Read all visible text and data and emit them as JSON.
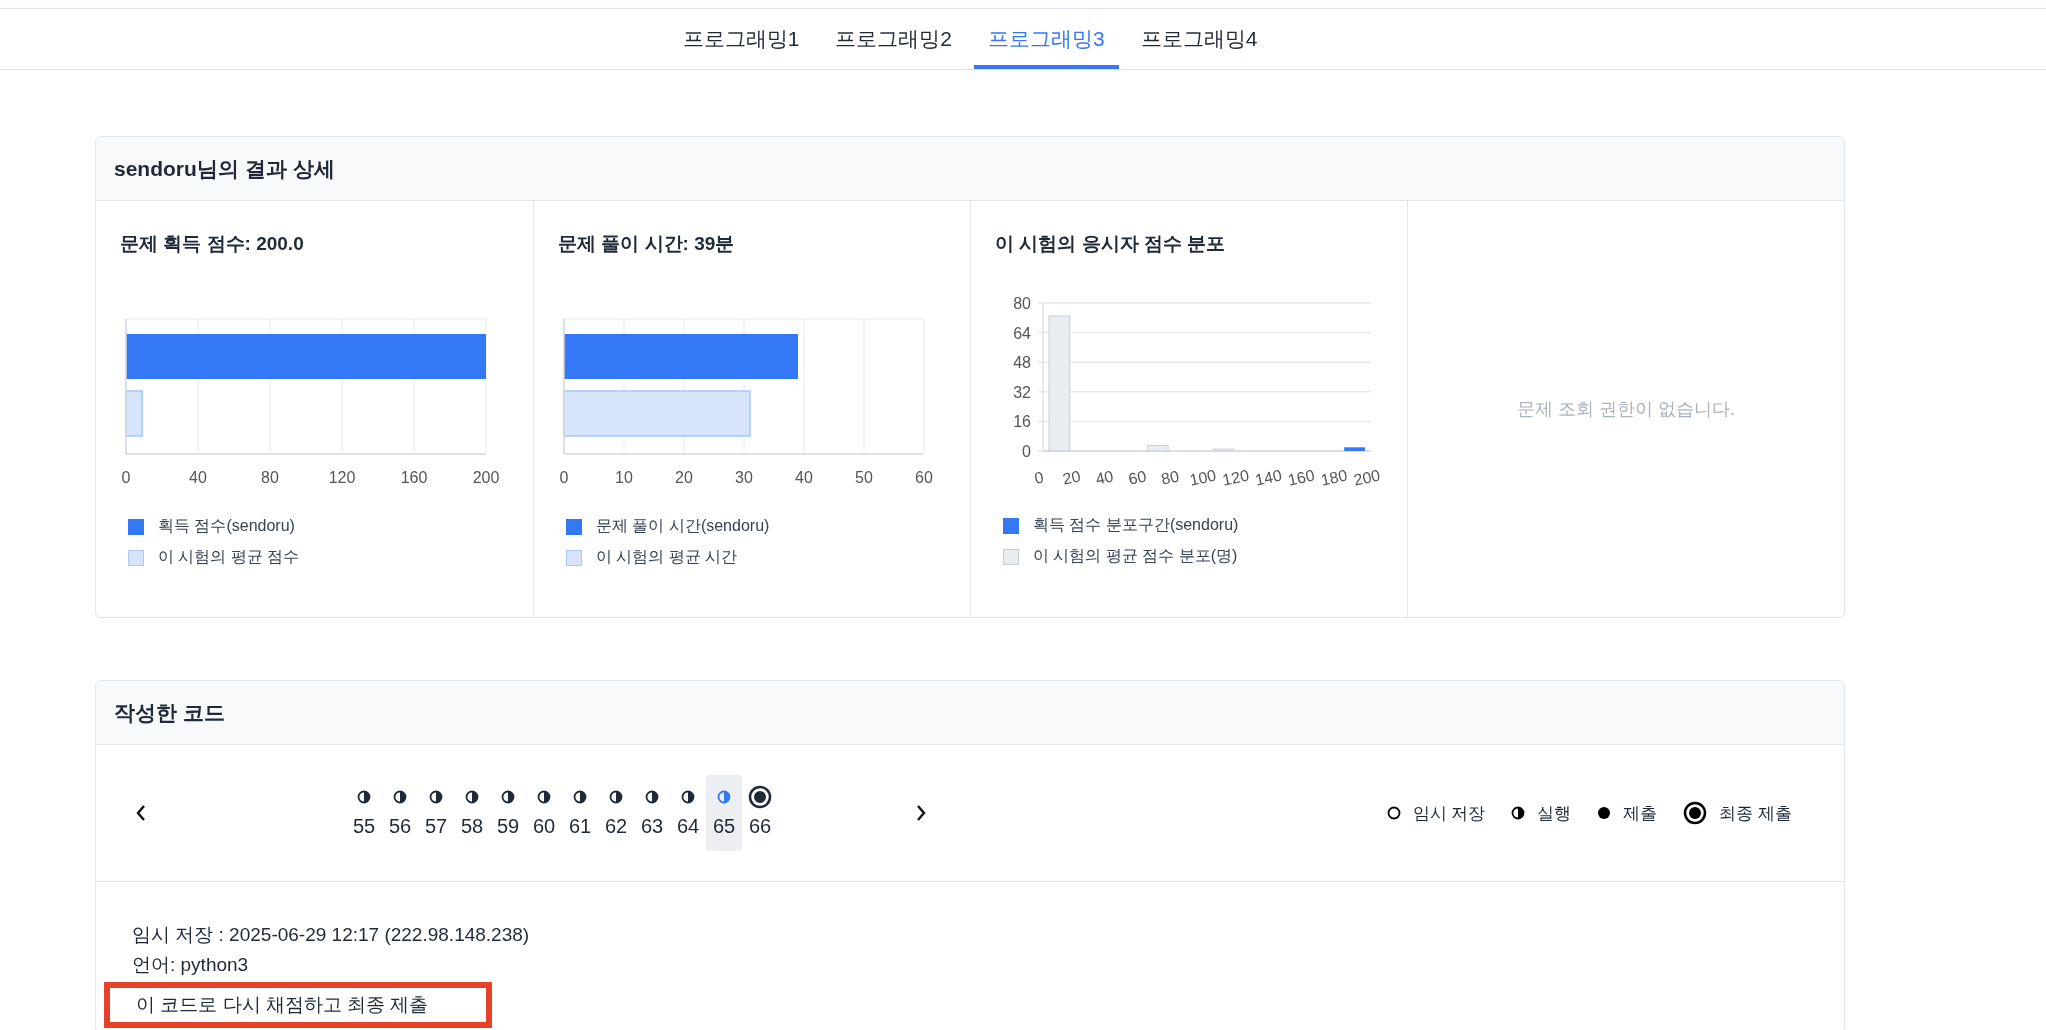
{
  "tabs": [
    {
      "label": "프로그래밍1",
      "selected": false
    },
    {
      "label": "프로그래밍2",
      "selected": false
    },
    {
      "label": "프로그래밍3",
      "selected": true
    },
    {
      "label": "프로그래밍4",
      "selected": false
    }
  ],
  "result": {
    "title": "sendoru님의 결과 상세",
    "panels": [
      {
        "kind": "hbar",
        "title": "문제 획득 점수: 200.0",
        "chart_data": {
          "type": "bar",
          "orientation": "horizontal",
          "grid": true,
          "xlim": [
            0,
            200
          ],
          "xticks": [
            0,
            40,
            80,
            120,
            160,
            200
          ],
          "series": [
            {
              "name": "획득 점수(sendoru)",
              "color": "#3478f6",
              "values": [
                200
              ]
            },
            {
              "name": "이 시험의 평균 점수",
              "color": "#d6e4fd",
              "values": [
                9
              ]
            }
          ]
        }
      },
      {
        "kind": "hbar",
        "title": "문제 풀이 시간: 39분",
        "chart_data": {
          "type": "bar",
          "orientation": "horizontal",
          "grid": true,
          "xlim": [
            0,
            60
          ],
          "xticks": [
            0,
            10,
            20,
            30,
            40,
            50,
            60
          ],
          "series": [
            {
              "name": "문제 풀이 시간(sendoru)",
              "color": "#3478f6",
              "values": [
                39
              ]
            },
            {
              "name": "이 시험의 평균 시간",
              "color": "#d6e4fd",
              "values": [
                31
              ]
            }
          ]
        }
      },
      {
        "kind": "histogram",
        "title": "이 시험의 응시자 점수 분포",
        "chart_data": {
          "type": "bar",
          "orientation": "vertical",
          "grid": true,
          "stacked": true,
          "x": [
            10,
            30,
            50,
            70,
            90,
            110,
            130,
            150,
            170,
            190
          ],
          "xlim": [
            0,
            200
          ],
          "ylim": [
            0,
            80
          ],
          "xticks": [
            0,
            20,
            40,
            60,
            80,
            100,
            120,
            140,
            160,
            180,
            200
          ],
          "yticks": [
            0,
            16,
            32,
            48,
            64,
            80
          ],
          "series": [
            {
              "name": "획득 점수 분포구간(sendoru)",
              "color": "#3478f6",
              "values": [
                0,
                0,
                0,
                0,
                0,
                0,
                0,
                0,
                0,
                2
              ]
            },
            {
              "name": "이 시험의 평균 점수 분포(명)",
              "color": "#e9ecf0",
              "values": [
                73,
                0,
                0,
                3,
                0,
                1,
                0,
                0,
                0,
                0
              ]
            }
          ]
        }
      },
      {
        "kind": "message",
        "text": "문제 조회 권한이 없습니다."
      }
    ]
  },
  "code": {
    "title": "작성한 코드",
    "submissions": [
      {
        "number": "55",
        "kind": "run",
        "selected": false
      },
      {
        "number": "56",
        "kind": "run",
        "selected": false
      },
      {
        "number": "57",
        "kind": "run",
        "selected": false
      },
      {
        "number": "58",
        "kind": "run",
        "selected": false
      },
      {
        "number": "59",
        "kind": "run",
        "selected": false
      },
      {
        "number": "60",
        "kind": "run",
        "selected": false
      },
      {
        "number": "61",
        "kind": "run",
        "selected": false
      },
      {
        "number": "62",
        "kind": "run",
        "selected": false
      },
      {
        "number": "63",
        "kind": "run",
        "selected": false
      },
      {
        "number": "64",
        "kind": "run",
        "selected": false
      },
      {
        "number": "65",
        "kind": "run",
        "selected": true
      },
      {
        "number": "66",
        "kind": "final",
        "selected": false
      }
    ],
    "legend": [
      {
        "kind": "temp",
        "label": "임시 저장"
      },
      {
        "kind": "run",
        "label": "실행"
      },
      {
        "kind": "submit",
        "label": "제출"
      },
      {
        "kind": "final",
        "label": "최종 제출"
      }
    ],
    "saved": "임시 저장 : 2025-06-29 12:17 (222.98.148.238)",
    "language": "언어: python3",
    "resubmit_button": "이 코드로 다시 채점하고 최종 제출"
  }
}
